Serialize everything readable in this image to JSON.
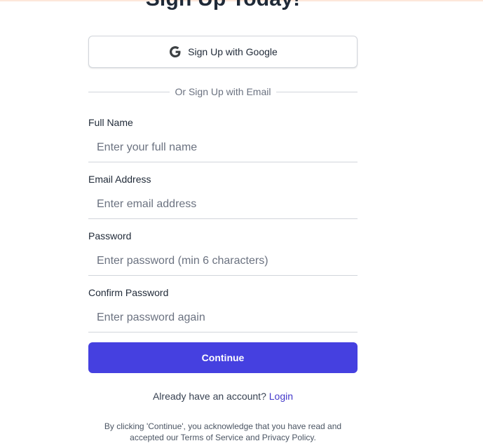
{
  "header": {
    "title": "Sign Up Today!"
  },
  "google": {
    "label": "Sign Up with Google",
    "icon": "google-icon"
  },
  "divider": {
    "label": "Or Sign Up with Email"
  },
  "form": {
    "full_name": {
      "label": "Full Name",
      "placeholder": "Enter your full name",
      "value": ""
    },
    "email": {
      "label": "Email Address",
      "placeholder": "Enter email address",
      "value": ""
    },
    "password": {
      "label": "Password",
      "placeholder": "Enter password (min 6 characters)",
      "value": ""
    },
    "confirm_password": {
      "label": "Confirm Password",
      "placeholder": "Enter password again",
      "value": ""
    }
  },
  "actions": {
    "continue_label": "Continue",
    "login_prompt": "Already have an account?",
    "login_link": "Login"
  },
  "legal": {
    "text": "By clicking 'Continue', you acknowledge that you have read and accepted our Terms of Service and Privacy Policy."
  },
  "colors": {
    "primary": "#4540e0",
    "link": "#4338ca",
    "top_border": "#fde7da"
  }
}
